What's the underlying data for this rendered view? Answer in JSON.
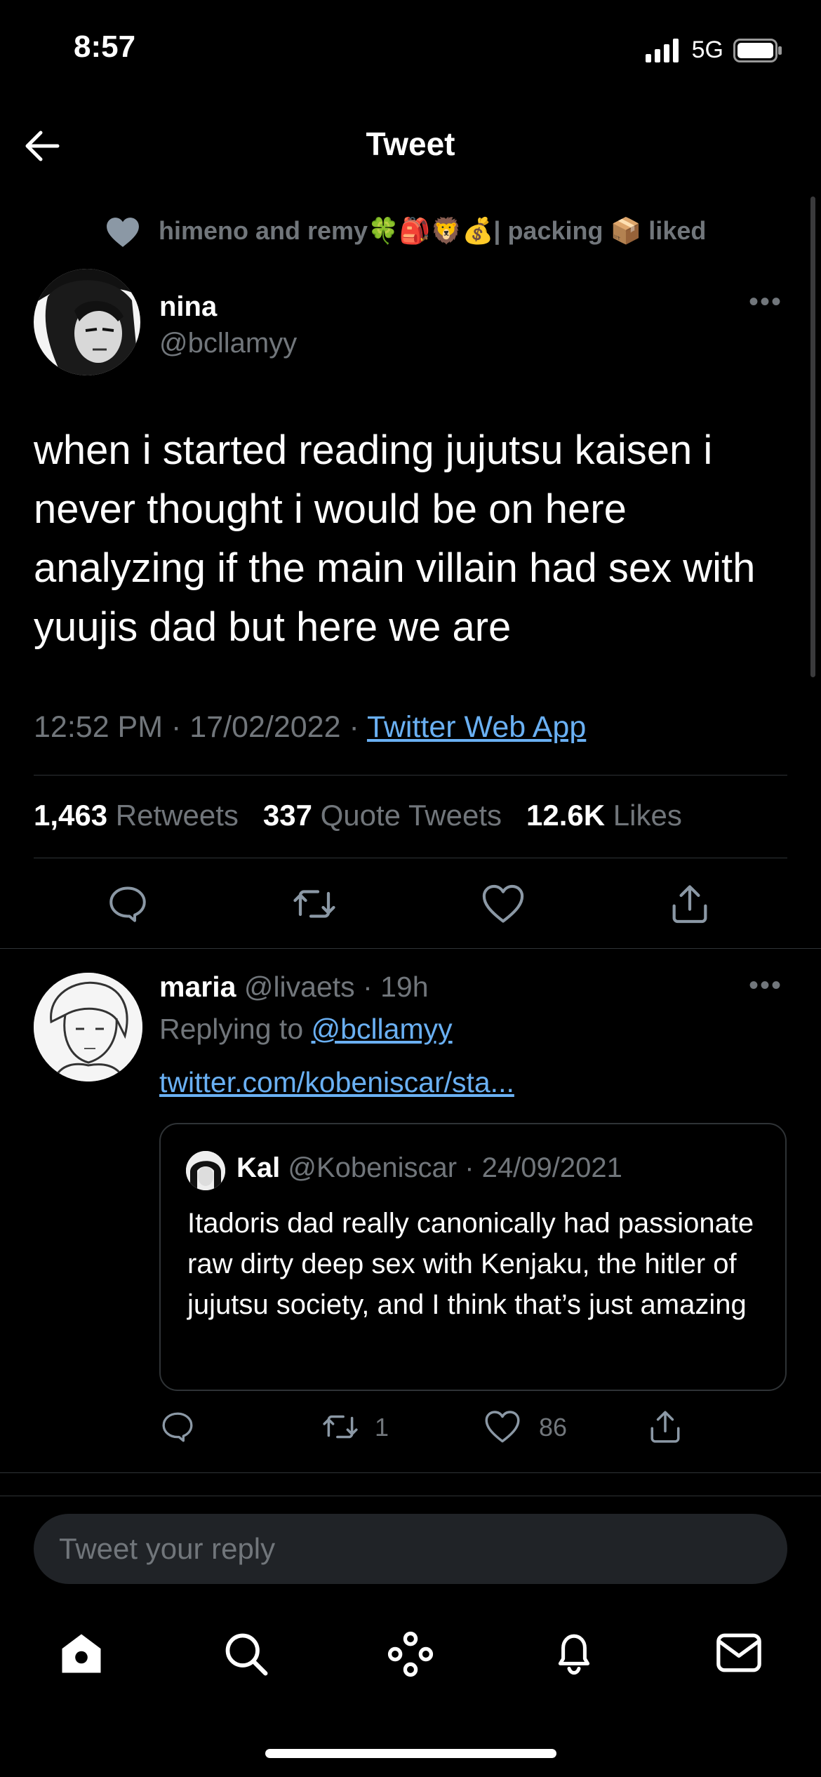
{
  "status_bar": {
    "time": "8:57",
    "network": "5G"
  },
  "header": {
    "title": "Tweet"
  },
  "social_context": {
    "text": "himeno and remy🍀🎒🦁💰| packing 📦 liked"
  },
  "tweet": {
    "author_name": "nina",
    "author_handle": "@bcllamyy",
    "text": "when i started reading jujutsu kaisen i never thought i would be on here analyzing if the main villain had sex with yuujis dad but here we are",
    "time": "12:52 PM",
    "date": "17/02/2022",
    "source": "Twitter Web App",
    "stats": {
      "retweets_count": "1,463",
      "retweets_label": "Retweets",
      "quotes_count": "337",
      "quotes_label": "Quote Tweets",
      "likes_count": "12.6K",
      "likes_label": "Likes"
    }
  },
  "reply": {
    "author_name": "maria",
    "author_handle": "@livaets",
    "time": "19h",
    "replying_prefix": "Replying to ",
    "replying_to": "@bcllamyy",
    "link": "twitter.com/kobeniscar/sta...",
    "quote": {
      "author_name": "Kal",
      "author_handle": "@Kobeniscar",
      "date": "24/09/2021",
      "text": "Itadoris dad really canonically had passionate raw dirty deep sex with Kenjaku, the hitler of jujutsu society, and I think that’s just amazing"
    },
    "retweets": "1",
    "likes": "86"
  },
  "composer": {
    "placeholder": "Tweet your reply"
  },
  "icons": {
    "back": "arrow-left-icon",
    "more": "more-dots-icon",
    "reply": "speech-bubble-icon",
    "retweet": "retweet-icon",
    "like": "heart-icon",
    "share": "share-icon",
    "home": "home-icon",
    "search": "search-icon",
    "spaces": "spaces-icon",
    "notifications": "bell-icon",
    "messages": "envelope-icon"
  }
}
